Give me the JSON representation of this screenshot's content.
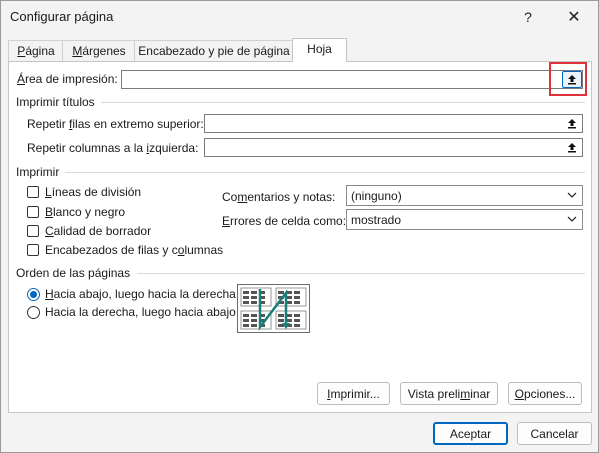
{
  "window": {
    "title": "Configurar página",
    "help_glyph": "?",
    "close_glyph": "✕"
  },
  "tabs": [
    {
      "pre": "",
      "accel": "P",
      "post": "ágina"
    },
    {
      "pre": "",
      "accel": "M",
      "post": "árgenes"
    },
    {
      "pre": "Encabezado y pie de página",
      "accel": "",
      "post": ""
    },
    {
      "pre": "Hoja",
      "accel": "",
      "post": ""
    }
  ],
  "print_area": {
    "pre": "",
    "accel": "Á",
    "post": "rea de impresión:",
    "value": ""
  },
  "print_titles": {
    "heading": "Imprimir títulos",
    "rows": {
      "pre": "Repetir ",
      "accel": "f",
      "post": "ilas en extremo superior:",
      "value": ""
    },
    "cols": {
      "pre": "Repetir columnas a la ",
      "accel": "i",
      "post": "zquierda:",
      "value": ""
    }
  },
  "print": {
    "heading": "Imprimir",
    "checks": [
      {
        "pre": "",
        "accel": "L",
        "post": "íneas de división",
        "checked": false
      },
      {
        "pre": "",
        "accel": "B",
        "post": "lanco y negro",
        "checked": false
      },
      {
        "pre": "",
        "accel": "C",
        "post": "alidad de borrador",
        "checked": false
      },
      {
        "pre": "Encabezados de filas y c",
        "accel": "o",
        "post": "lumnas",
        "checked": false
      }
    ],
    "comments_label": {
      "pre": "Co",
      "accel": "m",
      "post": "entarios y notas:"
    },
    "comments_value": "(ninguno)",
    "errors_label": {
      "pre": "",
      "accel": "E",
      "post": "rrores de celda como:"
    },
    "errors_value": "mostrado"
  },
  "page_order": {
    "heading": "Orden de las páginas",
    "options": [
      {
        "pre": "",
        "accel": "H",
        "post": "acia abajo, luego hacia la derecha",
        "selected": true
      },
      {
        "pre": "Hacia la derecha, luego hacia abajo",
        "accel": "",
        "post": "",
        "selected": false
      }
    ]
  },
  "buttons": {
    "imprimir": {
      "pre": "",
      "accel": "I",
      "post": "mprimir..."
    },
    "vista": {
      "pre": "Vista preli",
      "accel": "m",
      "post": "inar"
    },
    "opciones": {
      "pre": "",
      "accel": "O",
      "post": "pciones..."
    },
    "aceptar": "Aceptar",
    "cancelar": "Cancelar"
  },
  "colors": {
    "accent": "#0067c0",
    "highlight_box": "#e0313a",
    "preview_arrow": "#1a7f7a"
  },
  "icons": {
    "collapse": "collapse-dialog-icon",
    "dropdown": "chevron-down-icon",
    "help": "help-icon",
    "close": "close-icon"
  }
}
